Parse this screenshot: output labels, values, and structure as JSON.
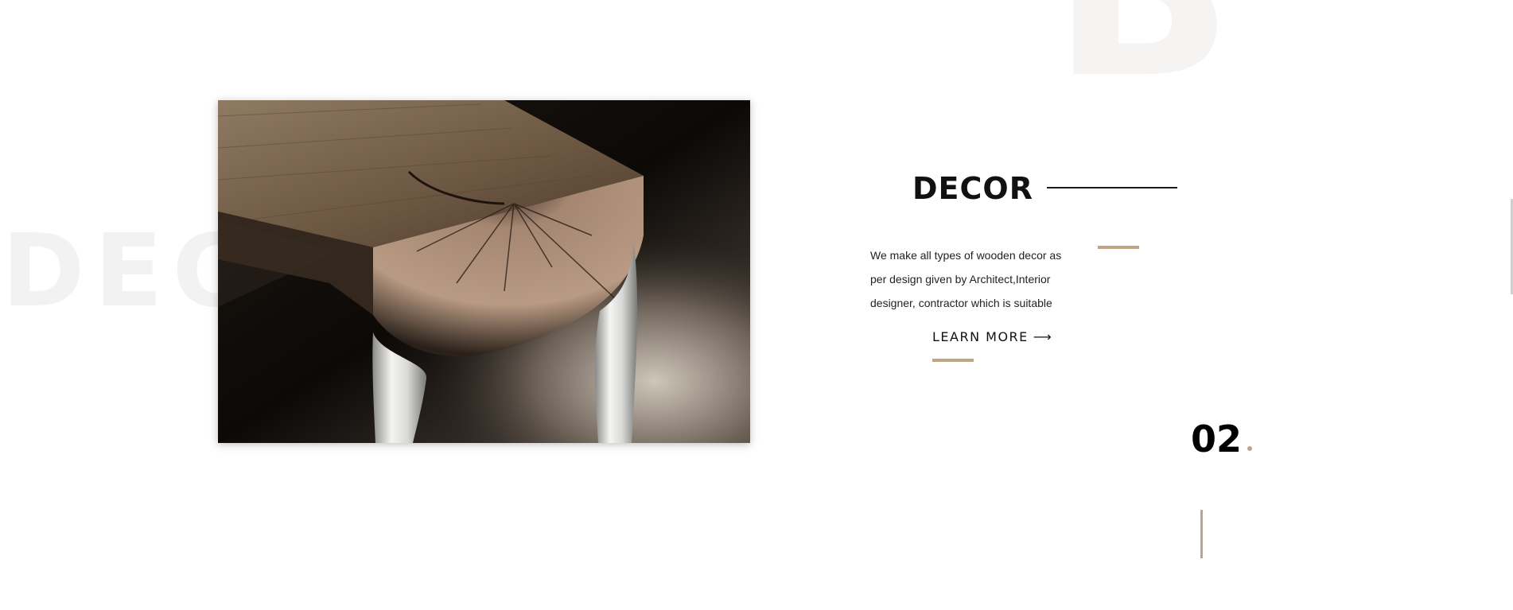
{
  "background": {
    "top_letter": "B",
    "side_word": "DECOR"
  },
  "feature": {
    "image_alt": "Wooden bench with cracked end grain and molten metal legs",
    "title": "DECOR",
    "description": "We make all types of wooden decor as per design given by Architect,Interior designer, contractor which is suitable",
    "cta_label": "LEARN MORE",
    "cta_icon": "arrow-right-icon"
  },
  "slide": {
    "number": "02",
    "dot": "."
  },
  "colors": {
    "accent": "#bca686",
    "text": "#111111",
    "background": "#ffffff",
    "watermark": "#f2f2f2"
  }
}
